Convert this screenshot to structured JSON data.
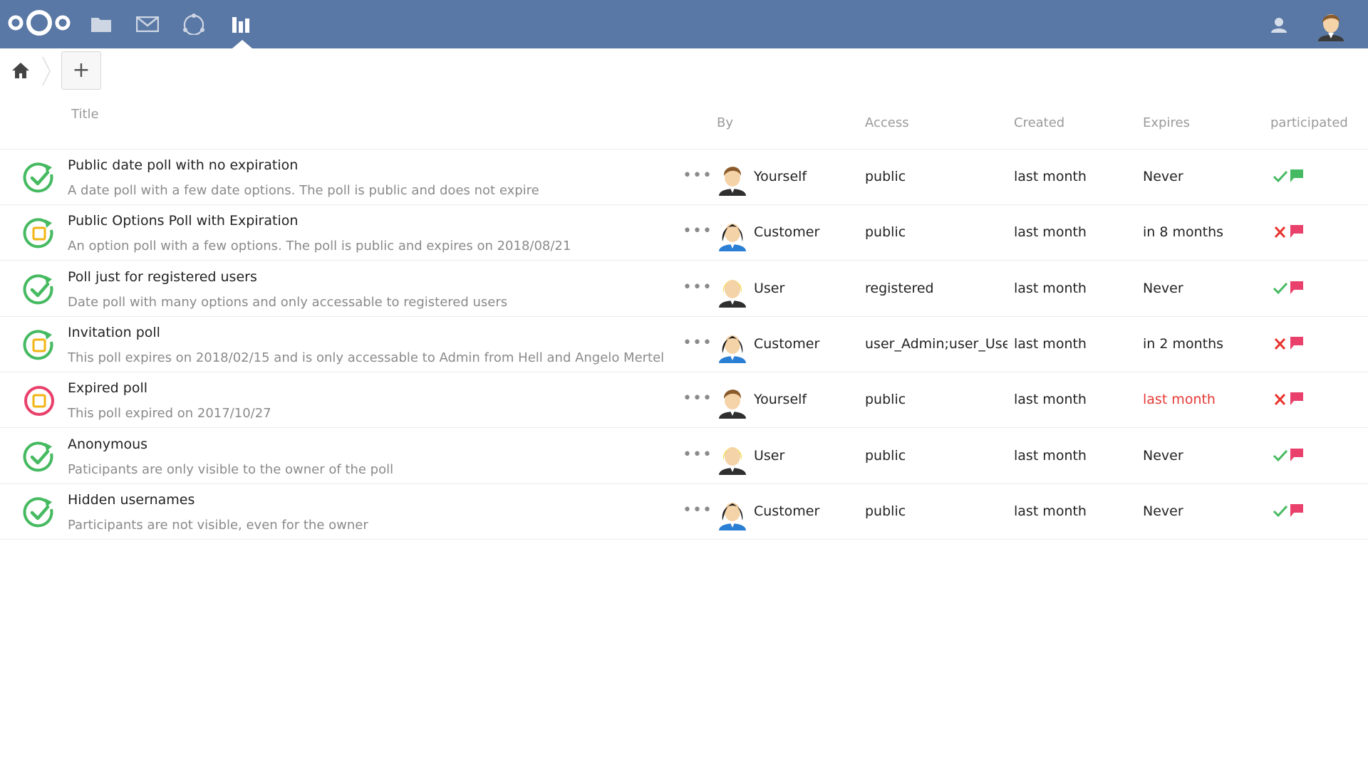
{
  "colors": {
    "header_bg": "#5a78a5",
    "green": "#46ba61",
    "red": "#e9322d",
    "amber": "#f0b413",
    "pink": "#e9416b"
  },
  "header": {
    "apps": [
      {
        "name": "files-icon"
      },
      {
        "name": "mail-icon"
      },
      {
        "name": "circles-icon"
      },
      {
        "name": "polls-icon",
        "active": true
      }
    ]
  },
  "breadcrumb": {
    "add_label": "+"
  },
  "table": {
    "columns": {
      "title": "Title",
      "by": "By",
      "access": "Access",
      "created": "Created",
      "expires": "Expires",
      "participated": "participated"
    },
    "rows": [
      {
        "status": "check",
        "title": "Public date poll with no expiration",
        "description": "A date poll with a few date options. The poll is public and does not expire",
        "owner": "Yourself",
        "avatar": "male",
        "access": "public",
        "created": "last month",
        "expires": "Never",
        "expired": false,
        "participated": true,
        "flag": "green"
      },
      {
        "status": "open",
        "title": "Public Options Poll with Expiration",
        "description": "An option poll with a few options. The poll is public and expires on 2018/08/21",
        "owner": "Customer",
        "avatar": "female",
        "access": "public",
        "created": "last month",
        "expires": "in 8 months",
        "expired": false,
        "participated": false,
        "flag": "red"
      },
      {
        "status": "check",
        "title": "Poll just for registered users",
        "description": "Date poll with many options and only accessable to registered users",
        "owner": "User",
        "avatar": "blonde",
        "access": "registered",
        "created": "last month",
        "expires": "Never",
        "expired": false,
        "participated": true,
        "flag": "red"
      },
      {
        "status": "open",
        "title": "Invitation poll",
        "description": "This poll expires on 2018/02/15 and is only accessable to Admin from Hell and Angelo Mertel",
        "owner": "Customer",
        "avatar": "female",
        "access": "user_Admin;user_User;",
        "created": "last month",
        "expires": "in 2 months",
        "expired": false,
        "participated": false,
        "flag": "red"
      },
      {
        "status": "expired",
        "title": "Expired poll",
        "description": "This poll expired on 2017/10/27",
        "owner": "Yourself",
        "avatar": "male",
        "access": "public",
        "created": "last month",
        "expires": "last month",
        "expired": true,
        "participated": false,
        "flag": "red"
      },
      {
        "status": "check",
        "title": "Anonymous",
        "description": "Paticipants are only visible to the owner of the poll",
        "owner": "User",
        "avatar": "blonde",
        "access": "public",
        "created": "last month",
        "expires": "Never",
        "expired": false,
        "participated": true,
        "flag": "red"
      },
      {
        "status": "check",
        "title": "Hidden usernames",
        "description": "Participants are not visible, even for the owner",
        "owner": "Customer",
        "avatar": "female",
        "access": "public",
        "created": "last month",
        "expires": "Never",
        "expired": false,
        "participated": true,
        "flag": "red"
      }
    ]
  }
}
